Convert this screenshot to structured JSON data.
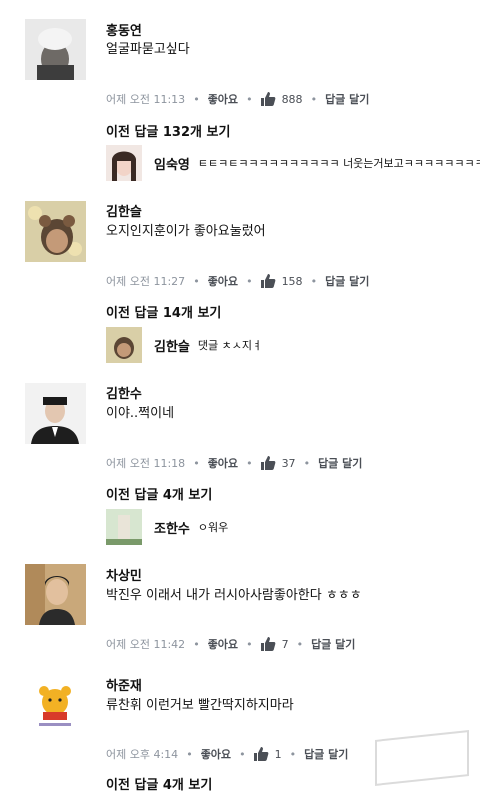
{
  "colors": {
    "meta": "#8d949e",
    "link": "#4b4f56",
    "like": "#4b4f56"
  },
  "comments": [
    {
      "name": "홍동연",
      "text": "얼굴파묻고싶다",
      "time": "어제 오전 11:13",
      "like_label": "좋아요",
      "likes": "888",
      "reply_label": "답글 달기",
      "more": "이전 답글 132개 보기",
      "reply": {
        "name": "임숙영",
        "text": "ㅌㅌㅋㅌㅋㅋㅋㅋㅋㅋㅋㅋㅋㅋ 너웃는거보고ㅋㅋㅋㅋㅋㅋㅋㅋ"
      }
    },
    {
      "name": "김한슬",
      "text": "오지인지훈이가 좋아요눌렀어",
      "time": "어제 오전 11:27",
      "like_label": "좋아요",
      "likes": "158",
      "reply_label": "답글 달기",
      "more": "이전 답글 14개 보기",
      "reply": {
        "name": "김한슬",
        "text": "댓글 ㅊㅅ지ㅕ"
      }
    },
    {
      "name": "김한수",
      "text": "이야..쩍이네",
      "time": "어제 오전 11:18",
      "like_label": "좋아요",
      "likes": "37",
      "reply_label": "답글 달기",
      "more": "이전 답글 4개 보기",
      "reply": {
        "name": "조한수",
        "text": "ㅇ워우"
      }
    },
    {
      "name": "차상민",
      "text": "박진우 이래서 내가 러시아사람좋아한다 ㅎㅎㅎ",
      "time": "어제 오전 11:42",
      "like_label": "좋아요",
      "likes": "7",
      "reply_label": "답글 달기"
    },
    {
      "name": "하준재",
      "text": "류찬휘 이런거보 빨간딱지하지마라",
      "time": "어제 오후 4:14",
      "like_label": "좋아요",
      "likes": "1",
      "reply_label": "답글 달기",
      "more": "이전 답글 4개 보기"
    }
  ]
}
